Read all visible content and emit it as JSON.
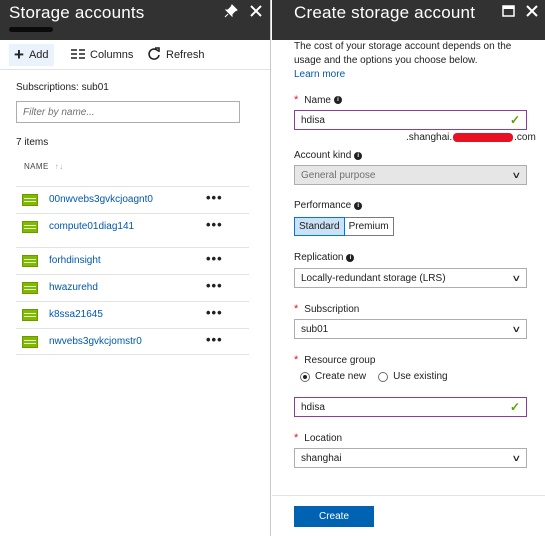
{
  "left": {
    "title": "Storage accounts",
    "toolbar": {
      "add": "Add",
      "columns": "Columns",
      "refresh": "Refresh"
    },
    "subscriptions": "Subscriptions: sub01",
    "filter_placeholder": "Filter by name...",
    "count": "7 items",
    "column_header": "NAME",
    "items": [
      {
        "name": "00nwvebs3gvkcjoagnt0"
      },
      {
        "name": "compute01diag141"
      },
      {
        "name": "forhdinsight"
      },
      {
        "name": "hwazurehd"
      },
      {
        "name": "k8ssa21645"
      },
      {
        "name": "nwvebs3gvkcjomstr0"
      }
    ]
  },
  "right": {
    "title": "Create storage account",
    "description": "The cost of your storage account depends on the usage and the options you choose below.",
    "learn_more": "Learn more",
    "name_label": "Name",
    "name_value": "hdisa",
    "suffix_prefix": ".shanghai.",
    "suffix_end": ".com",
    "account_kind_label": "Account kind",
    "account_kind_value": "General purpose",
    "performance_label": "Performance",
    "performance_options": [
      "Standard",
      "Premium"
    ],
    "replication_label": "Replication",
    "replication_value": "Locally-redundant storage (LRS)",
    "subscription_label": "Subscription",
    "subscription_value": "sub01",
    "resource_group_label": "Resource group",
    "resource_group_options": [
      "Create new",
      "Use existing"
    ],
    "resource_group_value": "hdisa",
    "location_label": "Location",
    "location_value": "shanghai",
    "create_button": "Create"
  },
  "icons": {
    "add": "plus-icon",
    "columns": "columns-icon",
    "refresh": "refresh-icon",
    "pin": "pin-icon",
    "close": "close-icon",
    "maximize": "maximize-icon",
    "storage": "storage-account-icon",
    "info": "info-icon",
    "check": "check-icon",
    "chevron": "chevron-down-icon"
  },
  "colors": {
    "header_bg": "#323232",
    "link": "#0058ad",
    "primary_button": "#0063b1",
    "valid_border": "#8a3d9a",
    "required": "#e81123",
    "valid_check": "#57a300"
  }
}
